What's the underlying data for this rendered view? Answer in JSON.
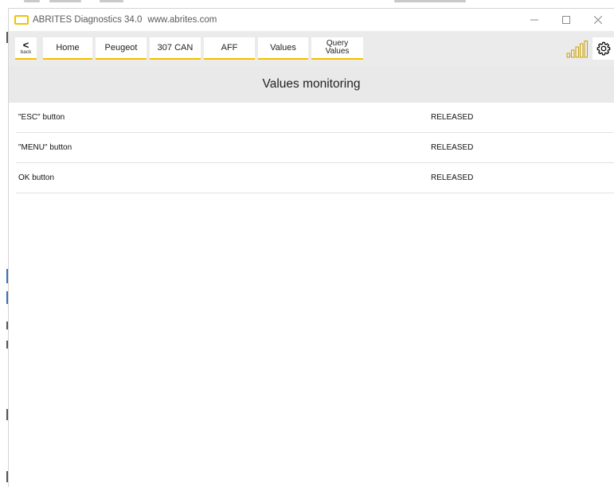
{
  "window": {
    "title": "ABRITES Diagnostics 34.0",
    "url": "www.abrites.com"
  },
  "toolbar": {
    "back_label": "back",
    "back_symbol": "<",
    "breadcrumbs": [
      "Home",
      "Peugeot",
      "307 CAN",
      "AFF",
      "Values"
    ],
    "query_values_line1": "Query",
    "query_values_line2": "Values",
    "accent_color": "#f2c200"
  },
  "page": {
    "header": "Values monitoring"
  },
  "values": [
    {
      "name": "\"ESC\" button",
      "value": "RELEASED"
    },
    {
      "name": "\"MENU\" button",
      "value": "RELEASED"
    },
    {
      "name": "OK button",
      "value": "RELEASED"
    }
  ],
  "icons": {
    "app_logo": "abrites-logo-icon",
    "signal": "signal-strength-icon",
    "settings": "gear-icon",
    "minimize": "minimize-icon",
    "maximize": "maximize-icon",
    "close": "close-icon"
  }
}
